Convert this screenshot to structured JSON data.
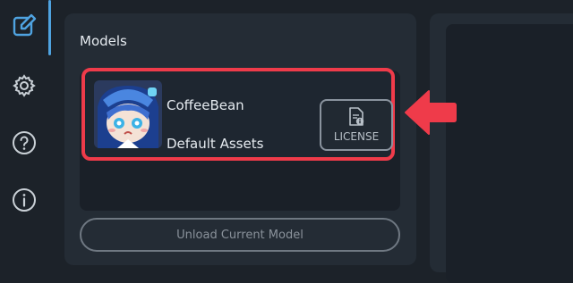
{
  "sidebar": {
    "items": [
      {
        "icon": "edit-icon",
        "active": true
      },
      {
        "icon": "gear-icon"
      },
      {
        "icon": "help-icon"
      },
      {
        "icon": "info-icon"
      }
    ]
  },
  "models_panel": {
    "title": "Models",
    "selected_model": {
      "name": "CoffeeBean",
      "source": "Default Assets",
      "license_label": "LICENSE"
    },
    "unload_label": "Unload Current Model"
  },
  "colors": {
    "accent": "#4fa3e0",
    "highlight": "#ef3b4a",
    "panel": "#242c35",
    "background": "#1c2229"
  }
}
